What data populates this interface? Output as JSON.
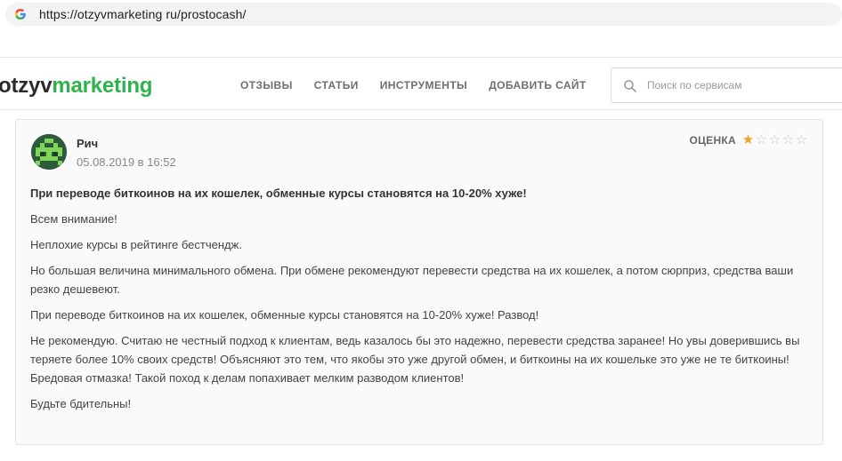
{
  "browser": {
    "url": "https://otzyvmarketing ru/prostocash/",
    "icon": "google-g-icon"
  },
  "header": {
    "logo_part1": "otzyv",
    "logo_part2": "marketing",
    "nav": [
      {
        "label": "ОТЗЫВЫ"
      },
      {
        "label": "СТАТЬИ"
      },
      {
        "label": "ИНСТРУМЕНТЫ"
      },
      {
        "label": "ДОБАВИТЬ САЙТ"
      }
    ],
    "search_placeholder": "Поиск по сервисам",
    "brand_color": "#2eb24a"
  },
  "review": {
    "author": "Рич",
    "date": "05.08.2019 в 16:52",
    "rating_label": "ОЦЕНКА",
    "rating_value": 1,
    "rating_max": 5,
    "headline": "При переводе биткоинов на их кошелек, обменные курсы становятся на 10-20% хуже!",
    "paragraphs": [
      "Всем внимание!",
      "Неплохие курсы в рейтинге бестчендж.",
      "Но большая величина минимального обмена. При обмене рекомендуют перевести средства на их кошелек, а потом сюрприз, средства ваши резко дешевеют.",
      "При переводе биткоинов на их кошелек, обменные курсы становятся на 10-20% хуже! Развод!",
      "Не рекомендую. Считаю не честный подход к клиентам, ведь казалось бы это надежно, перевести средства заранее! Но увы доверившись вы теряете более 10% своих средств! Объясняют это тем, что якобы это уже другой обмен, и биткоины на их кошельке это уже не те биткоины! Бредовая отмазка! Такой поход к делам попахивает мелким разводом клиентов!",
      "Будьте бдительны!"
    ],
    "star_color": "#f0a31d"
  }
}
